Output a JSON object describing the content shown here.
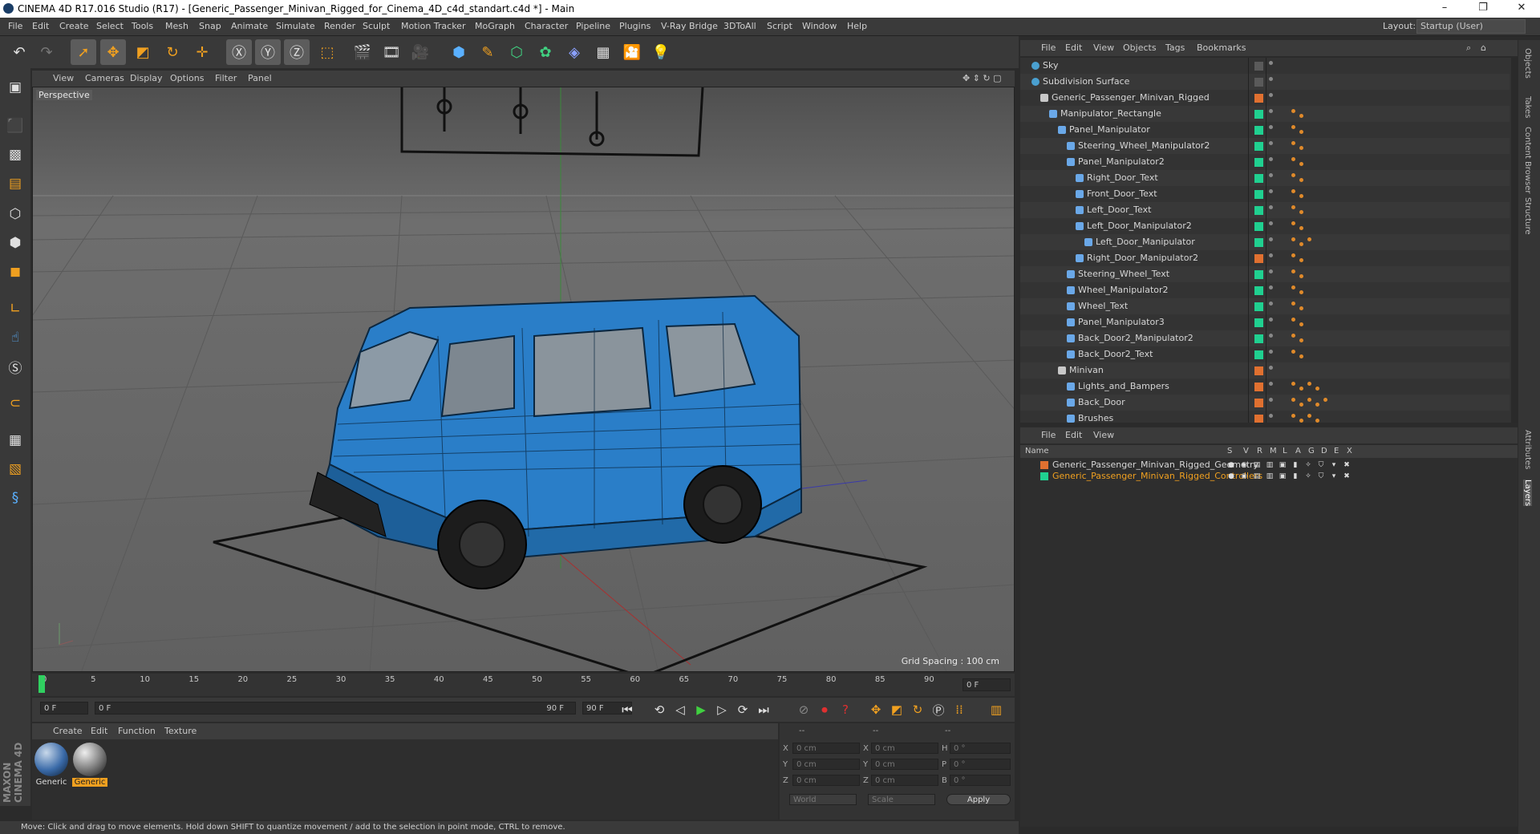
{
  "window": {
    "title": "CINEMA 4D R17.016 Studio (R17) - [Generic_Passenger_Minivan_Rigged_for_Cinema_4D_c4d_standart.c4d *] - Main",
    "minimize": "–",
    "maximize": "❐",
    "close": "✕"
  },
  "menubar": {
    "items": [
      "File",
      "Edit",
      "Create",
      "Select",
      "Tools",
      "Mesh",
      "Snap",
      "Animate",
      "Simulate",
      "Render",
      "Sculpt",
      "Motion Tracker",
      "MoGraph",
      "Character",
      "Pipeline",
      "Plugins",
      "V-Ray Bridge",
      "3DToAll",
      "Script",
      "Window",
      "Help"
    ],
    "layout_label": "Layout:",
    "layout_value": "Startup (User)"
  },
  "viewport": {
    "menu": [
      "View",
      "Cameras",
      "Display",
      "Options",
      "Filter",
      "Panel"
    ],
    "label": "Perspective",
    "grid_spacing": "Grid Spacing : 100 cm"
  },
  "timeline": {
    "ticks": [
      "0",
      "5",
      "10",
      "15",
      "20",
      "25",
      "30",
      "35",
      "40",
      "45",
      "50",
      "55",
      "60",
      "65",
      "70",
      "75",
      "80",
      "85",
      "90"
    ],
    "end_field": "0 F",
    "current": "0 F",
    "range_start": "0 F",
    "range_end": "90 F",
    "max": "90 F"
  },
  "material_manager": {
    "menu": [
      "Create",
      "Edit",
      "Function",
      "Texture"
    ],
    "materials": [
      {
        "label": "Generic",
        "selected": false
      },
      {
        "label": "Generic",
        "selected": true
      }
    ]
  },
  "coordinates": {
    "headers": [
      "--",
      "--",
      "--"
    ],
    "rows": [
      {
        "a": "X",
        "av": "0 cm",
        "b": "X",
        "bv": "0 cm",
        "c": "H",
        "cv": "0 °"
      },
      {
        "a": "Y",
        "av": "0 cm",
        "b": "Y",
        "bv": "0 cm",
        "c": "P",
        "cv": "0 °"
      },
      {
        "a": "Z",
        "av": "0 cm",
        "b": "Z",
        "bv": "0 cm",
        "c": "B",
        "cv": "0 °"
      }
    ],
    "mode": "World",
    "scale": "Scale",
    "apply": "Apply"
  },
  "status": "Move: Click and drag to move elements. Hold down SHIFT to quantize movement / add to the selection in point mode, CTRL to remove.",
  "object_manager": {
    "menu": [
      "File",
      "Edit",
      "View",
      "Objects",
      "Tags",
      "Bookmarks"
    ],
    "objects": [
      {
        "name": "Sky",
        "depth": 0,
        "color": "",
        "tags": 0
      },
      {
        "name": "Subdivision Surface",
        "depth": 0,
        "color": "",
        "tags": 0
      },
      {
        "name": "Generic_Passenger_Minivan_Rigged",
        "depth": 1,
        "color": "#e07030",
        "tags": 0
      },
      {
        "name": "Manipulator_Rectangle",
        "depth": 2,
        "color": "#20d090",
        "tags": 2
      },
      {
        "name": "Panel_Manipulator",
        "depth": 3,
        "color": "#20d090",
        "tags": 2
      },
      {
        "name": "Steering_Wheel_Manipulator2",
        "depth": 4,
        "color": "#20d090",
        "tags": 2
      },
      {
        "name": "Panel_Manipulator2",
        "depth": 4,
        "color": "#20d090",
        "tags": 2
      },
      {
        "name": "Right_Door_Text",
        "depth": 5,
        "color": "#20d090",
        "tags": 2
      },
      {
        "name": "Front_Door_Text",
        "depth": 5,
        "color": "#20d090",
        "tags": 2
      },
      {
        "name": "Left_Door_Text",
        "depth": 5,
        "color": "#20d090",
        "tags": 2
      },
      {
        "name": "Left_Door_Manipulator2",
        "depth": 5,
        "color": "#20d090",
        "tags": 2
      },
      {
        "name": "Left_Door_Manipulator",
        "depth": 6,
        "color": "#20d090",
        "tags": 3
      },
      {
        "name": "Right_Door_Manipulator2",
        "depth": 5,
        "color": "#e07030",
        "tags": 2
      },
      {
        "name": "Steering_Wheel_Text",
        "depth": 4,
        "color": "#20d090",
        "tags": 2
      },
      {
        "name": "Wheel_Manipulator2",
        "depth": 4,
        "color": "#20d090",
        "tags": 2
      },
      {
        "name": "Wheel_Text",
        "depth": 4,
        "color": "#20d090",
        "tags": 2
      },
      {
        "name": "Panel_Manipulator3",
        "depth": 4,
        "color": "#20d090",
        "tags": 2
      },
      {
        "name": "Back_Door2_Manipulator2",
        "depth": 4,
        "color": "#20d090",
        "tags": 2
      },
      {
        "name": "Back_Door2_Text",
        "depth": 4,
        "color": "#20d090",
        "tags": 2
      },
      {
        "name": "Minivan",
        "depth": 3,
        "color": "#e07030",
        "tags": 0
      },
      {
        "name": "Lights_and_Bampers",
        "depth": 4,
        "color": "#e07030",
        "tags": 4
      },
      {
        "name": "Back_Door",
        "depth": 4,
        "color": "#e07030",
        "tags": 5
      },
      {
        "name": "Brushes",
        "depth": 4,
        "color": "#e07030",
        "tags": 4
      }
    ]
  },
  "layer_manager": {
    "menu": [
      "File",
      "Edit",
      "View"
    ],
    "columns": [
      "Name",
      "S",
      "V",
      "R",
      "M",
      "L",
      "A",
      "G",
      "D",
      "E",
      "X"
    ],
    "layers": [
      {
        "name": "Generic_Passenger_Minivan_Rigged_Geometry",
        "color": "#e07030",
        "text_color": "#d6d6d6"
      },
      {
        "name": "Generic_Passenger_Minivan_Rigged_Controllers",
        "color": "#20d090",
        "text_color": "#f0a020"
      }
    ]
  },
  "side_tabs": [
    "Objects",
    "Takes",
    "Content Browser",
    "Structure",
    "Attributes",
    "Layers"
  ],
  "brand": "MAXON CINEMA 4D"
}
